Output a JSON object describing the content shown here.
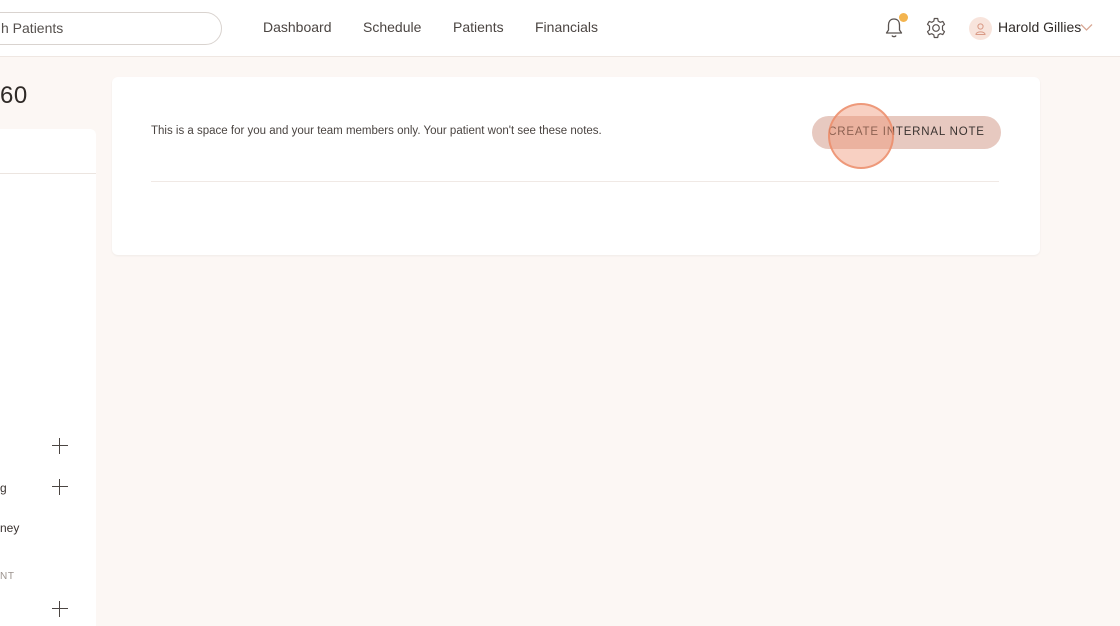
{
  "search": {
    "placeholder": "Search Patients",
    "visible_text": "h Patients"
  },
  "nav": {
    "items": [
      {
        "label": "Dashboard"
      },
      {
        "label": "Schedule"
      },
      {
        "label": "Patients"
      },
      {
        "label": "Financials"
      }
    ]
  },
  "header": {
    "user_name": "Harold Gillies",
    "notification_color": "#f3b44f"
  },
  "sidebar": {
    "patient_id_fragment": "60",
    "items": [
      {
        "label": ""
      },
      {
        "label": "g"
      },
      {
        "label": "ney"
      }
    ],
    "section_label": "NT"
  },
  "notes": {
    "info": "This is a space for you and your team members only. Your patient won't see these notes.",
    "create_button": "CREATE INTERNAL NOTE"
  },
  "colors": {
    "accent": "#e7c9c0",
    "background": "#fcf7f4",
    "click_highlight": "#f09678"
  }
}
